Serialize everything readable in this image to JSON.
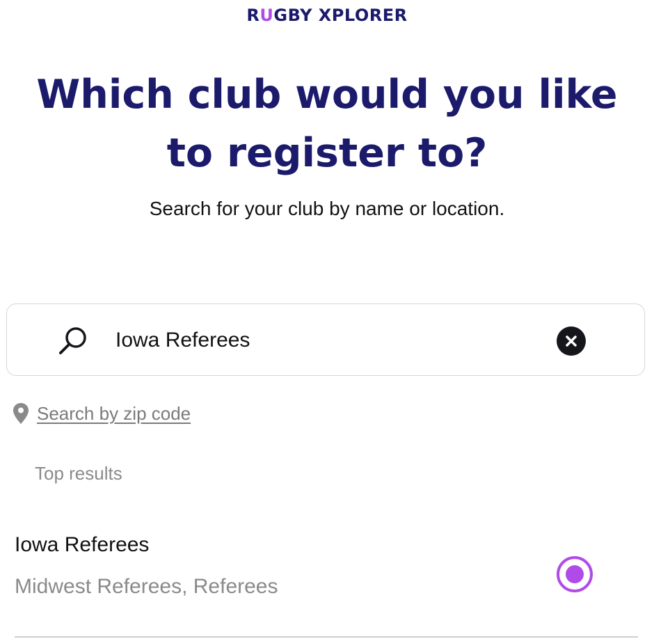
{
  "brand": {
    "logo_part1": "R",
    "logo_accent": "U",
    "logo_part2": "GBY XPLORER",
    "primary_color": "#1b1a6b",
    "accent_color": "#b04be8"
  },
  "page": {
    "heading": "Which club would you like to register to?",
    "subheading": "Search for your club by name or location."
  },
  "search": {
    "value": "Iowa Referees",
    "icon": "search-icon",
    "clear_icon": "close-icon"
  },
  "zip": {
    "icon": "map-pin-icon",
    "link_label": "Search by zip code"
  },
  "results": {
    "label": "Top results",
    "items": [
      {
        "name": "Iowa Referees",
        "subtitle": "Midwest Referees, Referees",
        "selected": true
      }
    ]
  }
}
